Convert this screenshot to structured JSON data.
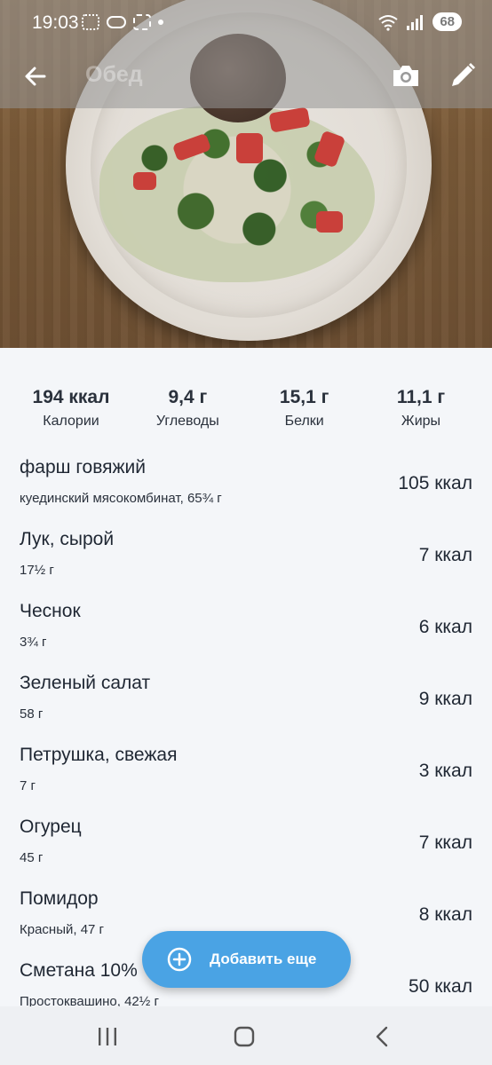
{
  "status_bar": {
    "time": "19:03",
    "battery": "68"
  },
  "app_bar": {
    "title": "Обед"
  },
  "summary": [
    {
      "value": "194 ккал",
      "label": "Калории"
    },
    {
      "value": "9,4 г",
      "label": "Углеводы"
    },
    {
      "value": "15,1 г",
      "label": "Белки"
    },
    {
      "value": "11,1 г",
      "label": "Жиры"
    }
  ],
  "foods": [
    {
      "name": "фарш говяжий",
      "detail": "куединский мясокомбинат, 65¾ г",
      "kcal": "105 ккал"
    },
    {
      "name": "Лук, сырой",
      "detail": "17½ г",
      "kcal": "7 ккал"
    },
    {
      "name": "Чеснок",
      "detail": "3¾ г",
      "kcal": "6 ккал"
    },
    {
      "name": "Зеленый салат",
      "detail": "58 г",
      "kcal": "9 ккал"
    },
    {
      "name": "Петрушка, свежая",
      "detail": "7 г",
      "kcal": "3 ккал"
    },
    {
      "name": "Огурец",
      "detail": "45 г",
      "kcal": "7 ккал"
    },
    {
      "name": "Помидор",
      "detail": "Красный, 47 г",
      "kcal": "8 ккал"
    },
    {
      "name": "Сметана 10%",
      "detail": "Простоквашино, 42½ г",
      "kcal": "50 ккал"
    }
  ],
  "fab": {
    "label": "Добавить еще"
  },
  "colors": {
    "accent": "#4aa3e4",
    "background": "#f4f6f9",
    "text": "#1f2733"
  },
  "icons": [
    "back-arrow-icon",
    "camera-icon",
    "pencil-icon",
    "plus-circle-icon",
    "recents-icon",
    "home-icon",
    "nav-back-icon"
  ]
}
